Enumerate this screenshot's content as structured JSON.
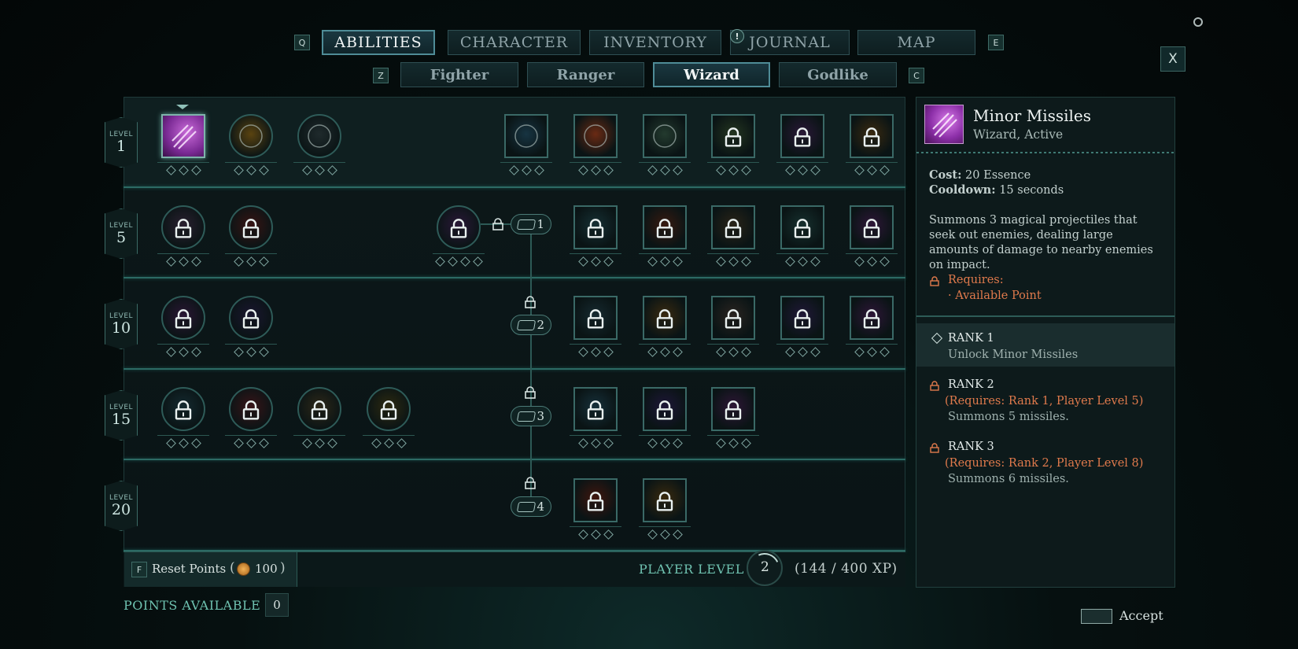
{
  "top_tabs": {
    "left_key": "Q",
    "right_key": "E",
    "tabs": [
      "ABILITIES",
      "CHARACTER",
      "INVENTORY",
      "JOURNAL",
      "MAP"
    ],
    "active": "ABILITIES",
    "journal_alert": "!"
  },
  "sub_tabs": {
    "left_key": "Z",
    "right_key": "C",
    "tabs": [
      "Fighter",
      "Ranger",
      "Wizard",
      "Godlike"
    ],
    "active": "Wizard"
  },
  "close_label": "X",
  "levels": [
    {
      "label": "LEVEL",
      "value": "1"
    },
    {
      "label": "LEVEL",
      "value": "5"
    },
    {
      "label": "LEVEL",
      "value": "10"
    },
    {
      "label": "LEVEL",
      "value": "15"
    },
    {
      "label": "LEVEL",
      "value": "20"
    }
  ],
  "tier_pills": [
    "1",
    "2",
    "3",
    "4"
  ],
  "colors": {
    "accent_teal": "#2c6a64",
    "requirement_orange": "#e07a4c",
    "selected_purple": "#a53fbf"
  },
  "footer": {
    "reset_key": "F",
    "reset_label": "Reset Points",
    "reset_cost": "100",
    "player_level_label": "PLAYER LEVEL",
    "player_level": "2",
    "xp": "(144 / 400 XP)",
    "points_available_label": "POINTS AVAILABLE",
    "points_available": "0",
    "accept_label": "Accept"
  },
  "detail": {
    "name": "Minor Missiles",
    "subtitle": "Wizard, Active",
    "cost_label": "Cost:",
    "cost_value": "20 Essence",
    "cooldown_label": "Cooldown:",
    "cooldown_value": "15 seconds",
    "description": "Summons 3 magical projectiles that seek out enemies, dealing large amounts of damage to nearby enemies on impact.",
    "requires_label": "Requires:",
    "requires_item": "· Available Point",
    "ranks": [
      {
        "title": "RANK 1",
        "req": "",
        "desc": "Unlock Minor Missiles"
      },
      {
        "title": "RANK 2",
        "req": "(Requires: Rank 1, Player Level 5)",
        "desc": "Summons 5 missiles."
      },
      {
        "title": "RANK 3",
        "req": "(Requires: Rank 2, Player Level 8)",
        "desc": "Summons 6 missiles."
      }
    ]
  }
}
